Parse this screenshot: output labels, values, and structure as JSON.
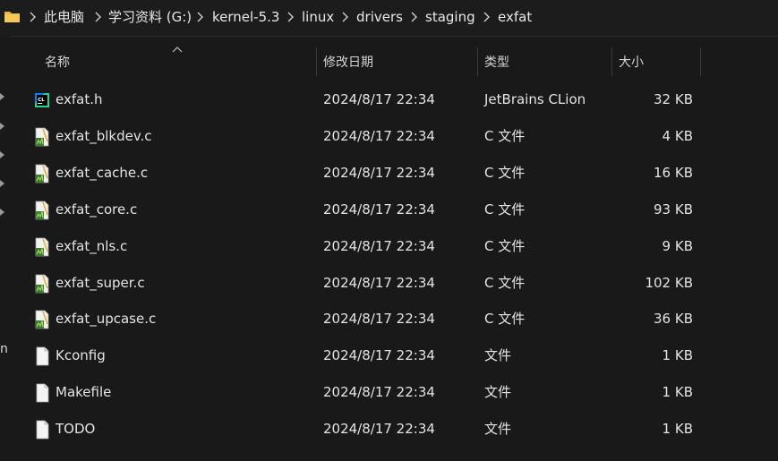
{
  "breadcrumb": {
    "items": [
      "此电脑",
      "学习资料 (G:)",
      "kernel-5.3",
      "linux",
      "drivers",
      "staging",
      "exfat"
    ]
  },
  "columns": {
    "name": "名称",
    "modified": "修改日期",
    "type": "类型",
    "size": "大小"
  },
  "left_rail_text": "n",
  "files": [
    {
      "name": "exfat.h",
      "modified": "2024/8/17 22:34",
      "type": "JetBrains CLion",
      "size": "32 KB",
      "icon": "clion-icon"
    },
    {
      "name": "exfat_blkdev.c",
      "modified": "2024/8/17 22:34",
      "type": "C 文件",
      "size": "4 KB",
      "icon": "c-file-icon"
    },
    {
      "name": "exfat_cache.c",
      "modified": "2024/8/17 22:34",
      "type": "C 文件",
      "size": "16 KB",
      "icon": "c-file-icon"
    },
    {
      "name": "exfat_core.c",
      "modified": "2024/8/17 22:34",
      "type": "C 文件",
      "size": "93 KB",
      "icon": "c-file-icon"
    },
    {
      "name": "exfat_nls.c",
      "modified": "2024/8/17 22:34",
      "type": "C 文件",
      "size": "9 KB",
      "icon": "c-file-icon"
    },
    {
      "name": "exfat_super.c",
      "modified": "2024/8/17 22:34",
      "type": "C 文件",
      "size": "102 KB",
      "icon": "c-file-icon"
    },
    {
      "name": "exfat_upcase.c",
      "modified": "2024/8/17 22:34",
      "type": "C 文件",
      "size": "36 KB",
      "icon": "c-file-icon"
    },
    {
      "name": "Kconfig",
      "modified": "2024/8/17 22:34",
      "type": "文件",
      "size": "1 KB",
      "icon": "blank-file-icon"
    },
    {
      "name": "Makefile",
      "modified": "2024/8/17 22:34",
      "type": "文件",
      "size": "1 KB",
      "icon": "blank-file-icon"
    },
    {
      "name": "TODO",
      "modified": "2024/8/17 22:34",
      "type": "文件",
      "size": "1 KB",
      "icon": "blank-file-icon"
    }
  ],
  "colors": {
    "background": "#191919",
    "text": "#e4e4e4",
    "folder": "#e8b64a",
    "clion": "#21d789"
  }
}
